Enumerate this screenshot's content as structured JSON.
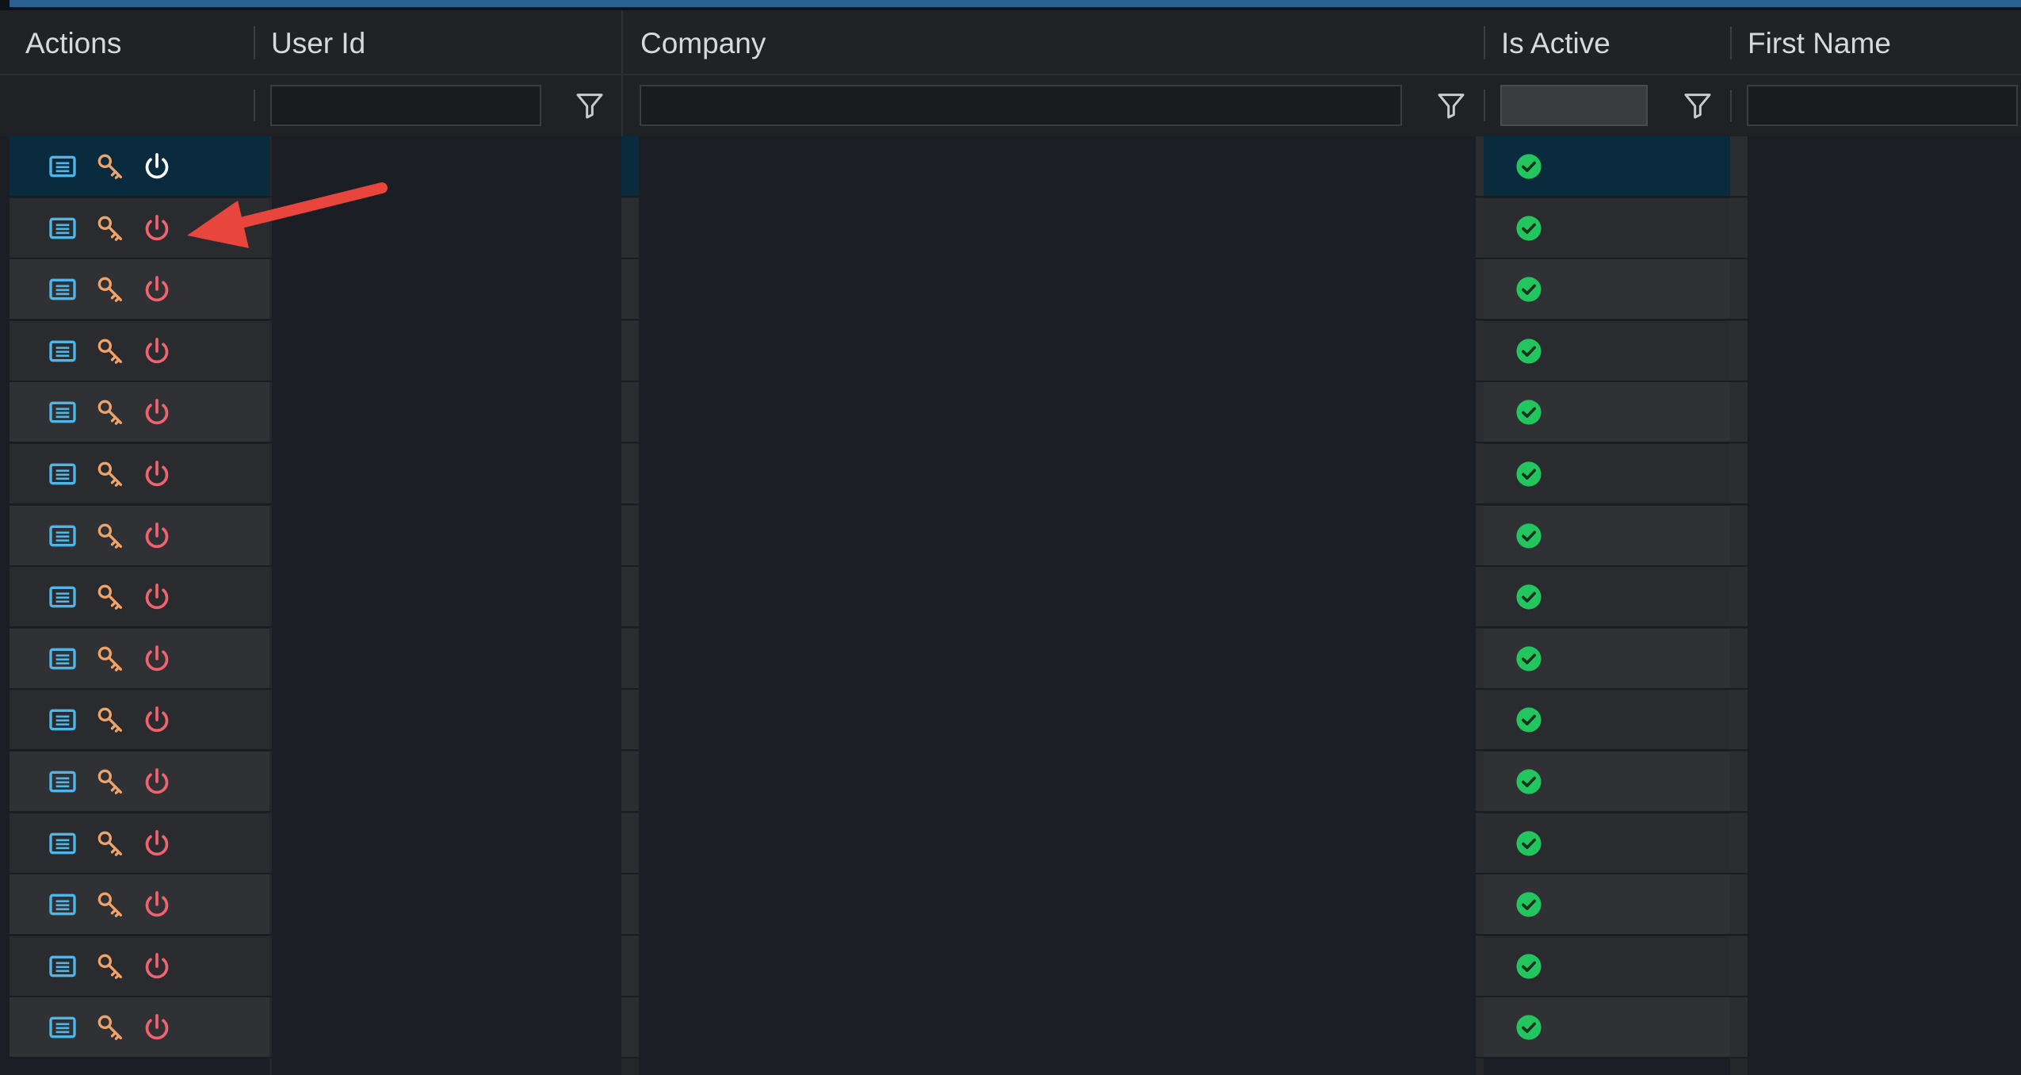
{
  "columns": {
    "actions": "Actions",
    "user_id": "User Id",
    "company": "Company",
    "is_active": "Is Active",
    "first_name": "First Name"
  },
  "filters": {
    "user_id": "",
    "company": "",
    "is_active": "",
    "first_name": ""
  },
  "rows": [
    {
      "is_active": true,
      "selected": true
    },
    {
      "is_active": true,
      "selected": false
    },
    {
      "is_active": true,
      "selected": false
    },
    {
      "is_active": true,
      "selected": false
    },
    {
      "is_active": true,
      "selected": false
    },
    {
      "is_active": true,
      "selected": false
    },
    {
      "is_active": true,
      "selected": false
    },
    {
      "is_active": true,
      "selected": false
    },
    {
      "is_active": true,
      "selected": false
    },
    {
      "is_active": true,
      "selected": false
    },
    {
      "is_active": true,
      "selected": false
    },
    {
      "is_active": true,
      "selected": false
    },
    {
      "is_active": true,
      "selected": false
    },
    {
      "is_active": true,
      "selected": false
    },
    {
      "is_active": true,
      "selected": false
    }
  ],
  "row_action_icons": [
    "details-icon",
    "key-icon",
    "power-icon"
  ],
  "colors": {
    "details_icon": "#4fb6e8",
    "key_icon": "#f0a46a",
    "power_icon": "#f06470",
    "power_icon_selected": "#ffffff",
    "active_check": "#22c55e",
    "annotation_arrow": "#e8453c",
    "accent_bar": "#2a5f8f"
  }
}
